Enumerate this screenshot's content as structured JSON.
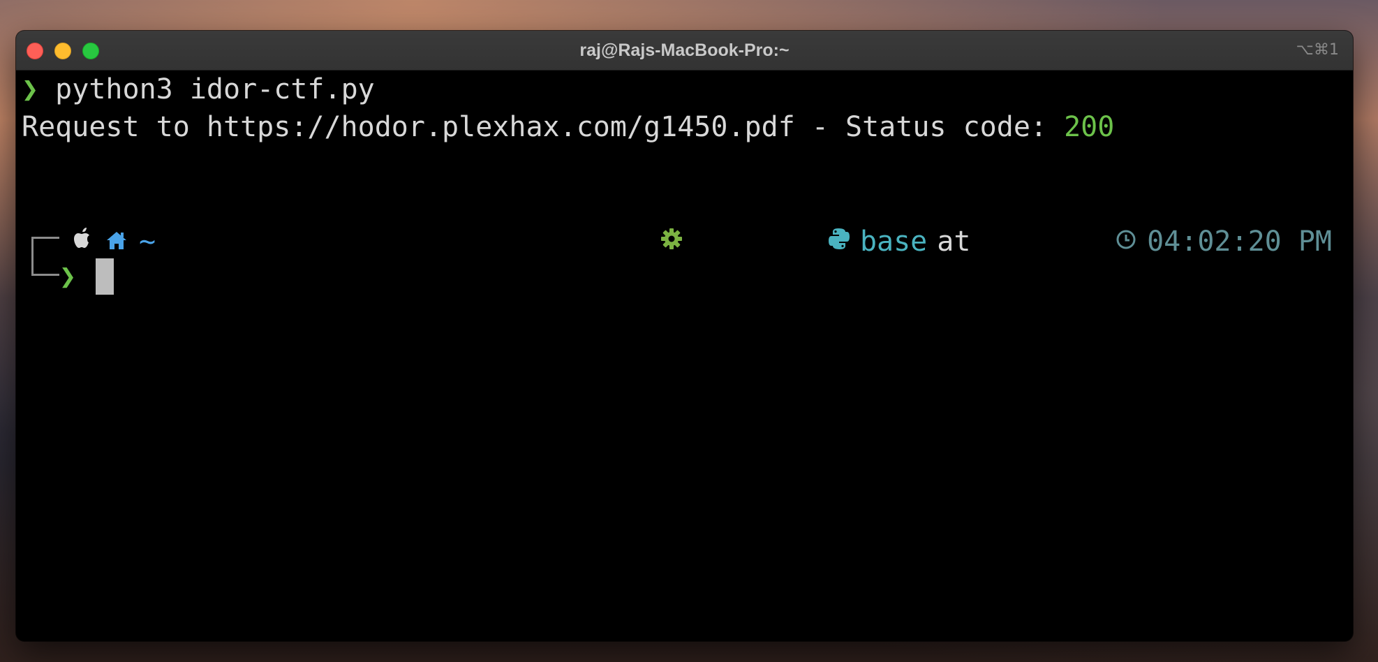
{
  "window": {
    "title": "raj@Rajs-MacBook-Pro:~",
    "shortcut": "⌥⌘1"
  },
  "terminal": {
    "command_prompt": "❯",
    "command": " python3 idor-ctf.py",
    "output_prefix": "Request to https://hodor.plexhax.com/g1450.pdf - Status code: ",
    "output_status": "200",
    "status_line": {
      "left_icons": [
        "apple-icon",
        "home-icon"
      ],
      "cwd": "~",
      "right_icons": [
        "gear-icon",
        "python-icon",
        "clock-icon"
      ],
      "env_name": "base",
      "at_text": "at",
      "time": "04:02:20 PM"
    },
    "input_prompt": "❯"
  },
  "colors": {
    "prompt_green": "#6cc24a",
    "status_ok": "#6cc24a",
    "home_blue": "#4aa3e8",
    "env_teal": "#4ab3c0",
    "time_gray_teal": "#5f8f96",
    "gear_green": "#7cb342",
    "python_teal": "#4ab3c0"
  }
}
